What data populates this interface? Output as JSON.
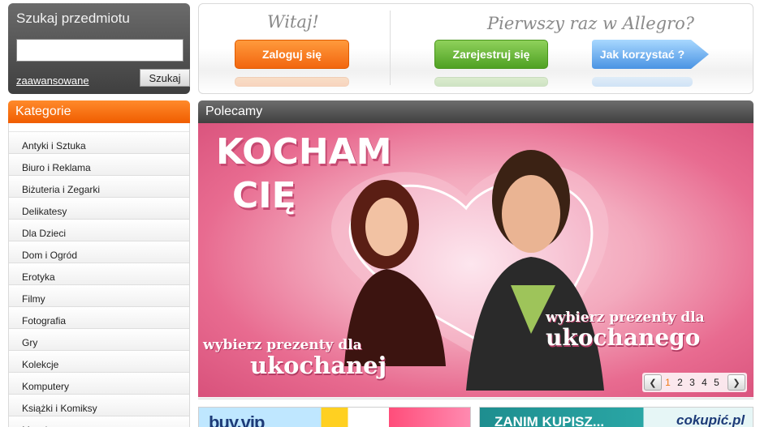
{
  "search": {
    "title": "Szukaj przedmiotu",
    "input_value": "",
    "advanced_link": "zaawansowane",
    "button_label": "Szukaj"
  },
  "welcome": {
    "left_heading": "Witaj!",
    "login_button": "Zaloguj się",
    "right_heading": "Pierwszy raz w Allegro?",
    "register_button": "Zarejestruj się",
    "howto_button": "Jak korzystać ?"
  },
  "categories": {
    "header": "Kategorie",
    "items": [
      "Antyki i Sztuka",
      "Biuro i Reklama",
      "Biżuteria i Zegarki",
      "Delikatesy",
      "Dla Dzieci",
      "Dom i Ogród",
      "Erotyka",
      "Filmy",
      "Fotografia",
      "Gry",
      "Kolekcje",
      "Komputery",
      "Książki i Komiksy",
      "Muzyka"
    ]
  },
  "featured": {
    "header": "Polecamy",
    "banner": {
      "headline_line1": "KOCHAM",
      "headline_line2": "CIĘ",
      "left_caption_line1": "wybierz prezenty dla",
      "left_caption_line2": "ukochanej",
      "right_caption_line1": "wybierz prezenty dla",
      "right_caption_line2": "ukochanego"
    },
    "pager": {
      "prev_icon": "chevron-left-icon",
      "next_icon": "chevron-right-icon",
      "pages": [
        "1",
        "2",
        "3",
        "4",
        "5"
      ],
      "active_page": "1"
    }
  },
  "promos": {
    "left_text": "buy.vip",
    "right_text": "ZANIM KUPISZ...",
    "right_brand": "cokupić.pl"
  },
  "colors": {
    "accent_orange": "#f05d00",
    "login_orange": "#f2660f",
    "register_green": "#4fa123",
    "howto_blue": "#4f9be8",
    "header_dark": "#404040",
    "banner_pink": "#e86b90"
  }
}
